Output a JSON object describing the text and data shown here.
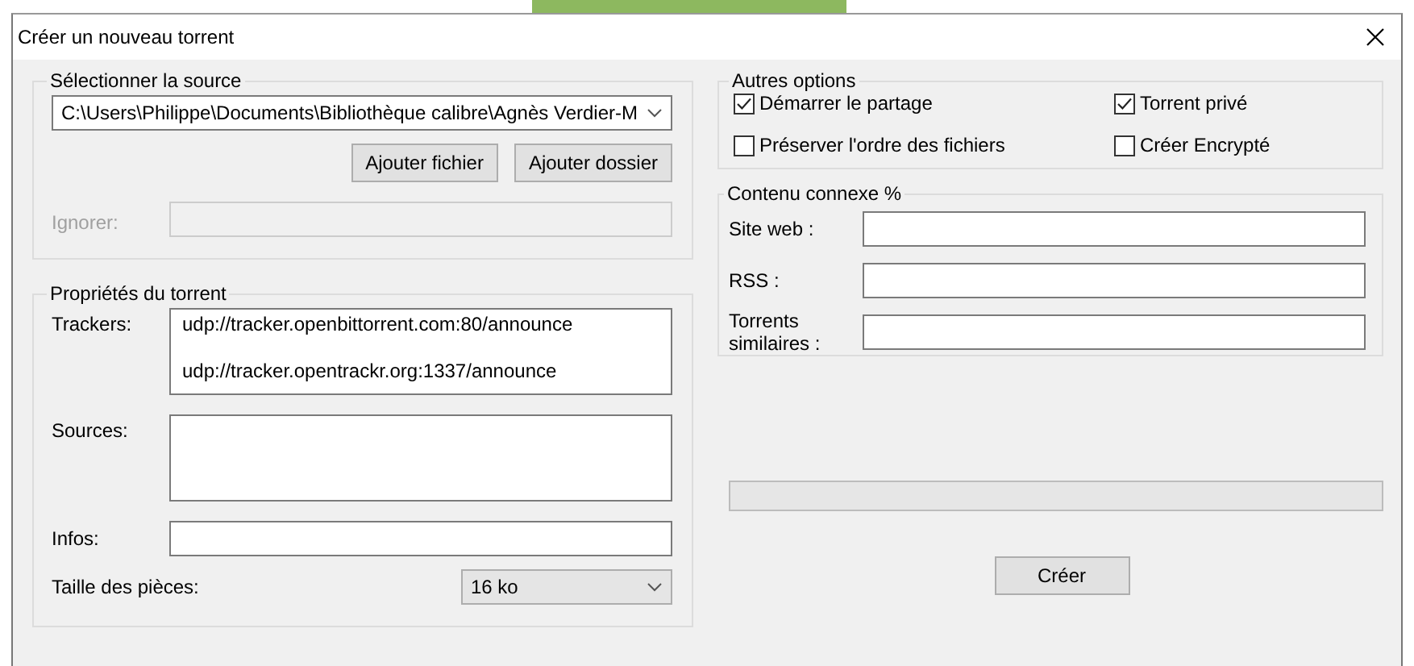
{
  "window": {
    "title": "Créer un nouveau torrent"
  },
  "source": {
    "legend": "Sélectionner la source",
    "path": "C:\\Users\\Philippe\\Documents\\Bibliothèque calibre\\Agnès Verdier-M",
    "buttons": [
      "Ajouter fichier",
      "Ajouter dossier"
    ],
    "ignore": {
      "label": "Ignorer:",
      "disabled": true
    }
  },
  "properties": {
    "legend": "Propriétés du torrent",
    "trackers": {
      "label": "Trackers:",
      "lines": [
        "udp://tracker.openbittorrent.com:80/announce",
        "udp://tracker.opentrackr.org:1337/announce"
      ]
    },
    "sources": {
      "label": "Sources:"
    },
    "infos": {
      "label": "Infos:"
    },
    "piece_size": {
      "label": "Taille des pièces:",
      "value": "16 ko"
    }
  },
  "other_options": {
    "legend": "Autres options",
    "options": [
      {
        "label": "Démarrer le partage",
        "checked": true
      },
      {
        "label": "Torrent privé",
        "checked": true
      },
      {
        "label": "Préserver l'ordre des fichiers",
        "checked": false
      },
      {
        "label": "Créer Encrypté",
        "checked": false
      }
    ]
  },
  "related": {
    "legend": "Contenu connexe %",
    "fields": [
      {
        "label": "Site web :"
      },
      {
        "label": "RSS :"
      },
      {
        "label": "Torrents similaires :"
      }
    ]
  },
  "progress": {
    "level": 0
  },
  "create_button": "Créer"
}
